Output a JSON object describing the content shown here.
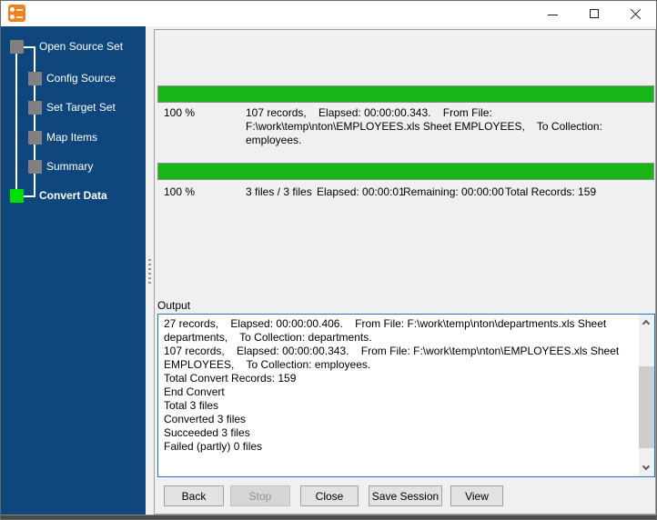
{
  "colors": {
    "sidebar_bg": "#0F477D",
    "step_pending_square": "#808080",
    "step_active_square": "#00DF00",
    "progress_fill_green": "#17B517",
    "output_focus_border": "#2277C4",
    "panel_bg": "#F0F0F0",
    "titlebar_bg": "#FFFFFF",
    "app_icon_orange": "#E8831D"
  },
  "icons": {
    "app_icon": "orange-rounded-square-converter-logo",
    "minimize_icon": "horizontal-line",
    "maximize_icon": "hollow-square",
    "close_icon": "diagonal-cross",
    "scroll_up_icon": "chevron-up",
    "scroll_down_icon": "chevron-down",
    "splitter_grip_icon": "vertical-dots"
  },
  "sidebar": {
    "steps": [
      {
        "label": "Open Source Set",
        "level": 0,
        "state": "done"
      },
      {
        "label": "Config Source",
        "level": 1,
        "state": "done"
      },
      {
        "label": "Set Target Set",
        "level": 1,
        "state": "done"
      },
      {
        "label": "Map Items",
        "level": 1,
        "state": "done"
      },
      {
        "label": "Summary",
        "level": 1,
        "state": "done"
      },
      {
        "label": "Convert Data",
        "level": 0,
        "state": "active"
      }
    ]
  },
  "file_progress": {
    "percent": 100,
    "percent_label": "100 %",
    "detail_lines": [
      "107 records,    Elapsed: 00:00:00.343.    From File:",
      "F:\\work\\temp\\nton\\EMPLOYEES.xls Sheet EMPLOYEES,    To Collection: employees."
    ]
  },
  "overall_progress": {
    "percent": 100,
    "percent_label": "100 %",
    "files": "3 files / 3 files",
    "elapsed": "Elapsed: 00:00:01",
    "remaining": "Remaining: 00:00:00",
    "total_records": "Total Records: 159"
  },
  "output": {
    "label": "Output",
    "lines": [
      "27 records,    Elapsed: 00:00:00.406.    From File: F:\\work\\temp\\nton\\departments.xls Sheet",
      "departments,    To Collection: departments.",
      "107 records,    Elapsed: 00:00:00.343.    From File: F:\\work\\temp\\nton\\EMPLOYEES.xls Sheet",
      "EMPLOYEES,    To Collection: employees.",
      "Total Convert Records: 159",
      "End Convert",
      "Total 3 files",
      "Converted 3 files",
      "Succeeded 3 files",
      "Failed (partly) 0 files"
    ]
  },
  "buttons": [
    {
      "label": "Back",
      "enabled": true
    },
    {
      "label": "Stop",
      "enabled": false
    },
    {
      "label": "Close",
      "enabled": true
    },
    {
      "label": "Save Session",
      "enabled": true
    },
    {
      "label": "View",
      "enabled": true
    }
  ]
}
